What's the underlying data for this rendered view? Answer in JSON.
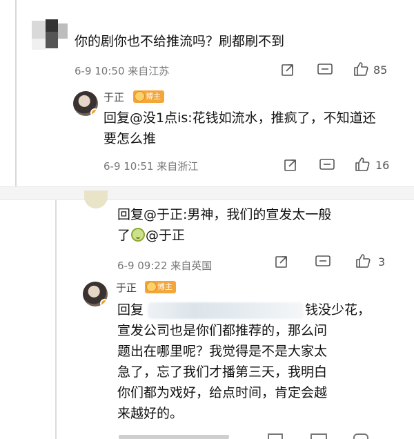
{
  "comment1": {
    "text": "你的剧你也不给推流吗？刷都刷不到",
    "meta": "6-9 10:50 来自江苏",
    "likes": "85",
    "icons": [
      "share-icon",
      "comment-icon",
      "like-icon"
    ]
  },
  "reply1": {
    "name": "于正",
    "badge": "博主",
    "line1": "回复@没1点is:花钱如流水，推疯了，不知道还",
    "line2": "要怎么推",
    "meta": "6-9 10:51 来自浙江",
    "likes": "16"
  },
  "comment2": {
    "line1": "回复@于正:男神，我们的宣发太一般",
    "line2_a": "了",
    "line2_b": "@于正",
    "meta": "6-9 09:22 来自英国",
    "likes": "3"
  },
  "reply2": {
    "name": "于正",
    "badge": "博主",
    "line1_a": "回复",
    "line1_b": "钱没少花，",
    "line2": "宣发公司也是你们都推荐的，那么问",
    "line3": "题出在哪里呢？我觉得是不是大家太",
    "line4": "急了，忘了我们才播第三天，我明白",
    "line5": "你们都为戏好，给点时间，肯定会越",
    "line6": "来越好的。"
  },
  "colors": {
    "badge": "#f4a63a",
    "meta": "#777777",
    "text": "#111111"
  }
}
